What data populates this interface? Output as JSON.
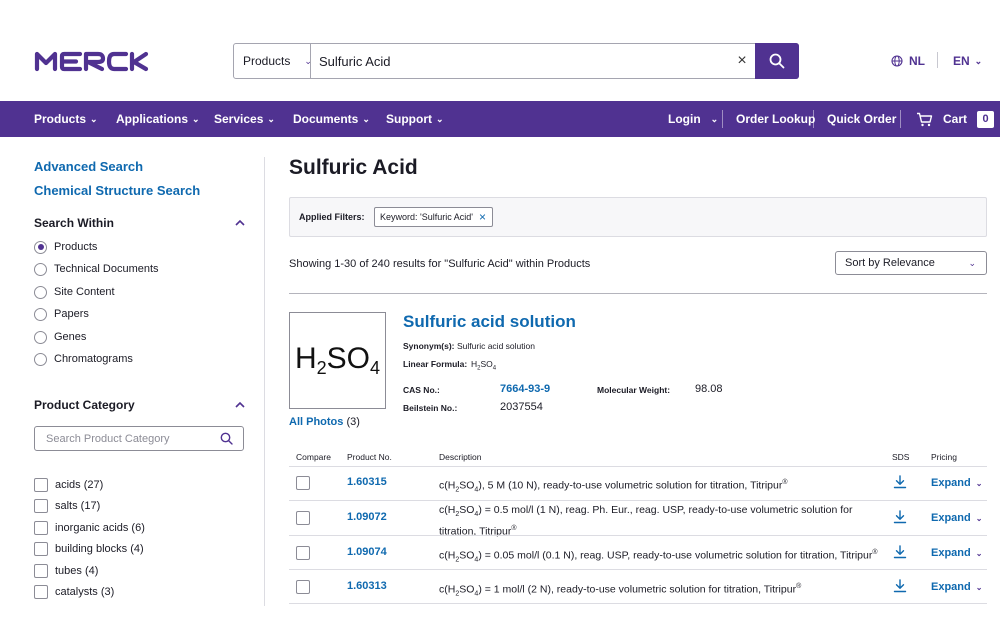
{
  "header": {
    "logo_text": "MERCK",
    "search_scope": "Products",
    "search_value": "Sulfuric Acid",
    "country": "NL",
    "language": "EN"
  },
  "nav": {
    "items": [
      {
        "label": "Products"
      },
      {
        "label": "Applications"
      },
      {
        "label": "Services"
      },
      {
        "label": "Documents"
      },
      {
        "label": "Support"
      }
    ],
    "login": "Login",
    "order_lookup": "Order Lookup",
    "quick_order": "Quick Order",
    "cart": "Cart",
    "cart_count": "0"
  },
  "sidebar": {
    "advanced_search": "Advanced Search",
    "structure_search": "Chemical Structure Search",
    "search_within_title": "Search Within",
    "search_within": [
      {
        "label": "Products",
        "selected": true
      },
      {
        "label": "Technical Documents",
        "selected": false
      },
      {
        "label": "Site Content",
        "selected": false
      },
      {
        "label": "Papers",
        "selected": false
      },
      {
        "label": "Genes",
        "selected": false
      },
      {
        "label": "Chromatograms",
        "selected": false
      }
    ],
    "category_title": "Product Category",
    "category_placeholder": "Search Product Category",
    "categories": [
      {
        "label": "acids (27)"
      },
      {
        "label": "salts (17)"
      },
      {
        "label": "inorganic acids (6)"
      },
      {
        "label": "building blocks (4)"
      },
      {
        "label": "tubes (4)"
      },
      {
        "label": "catalysts (3)"
      }
    ]
  },
  "main": {
    "title": "Sulfuric Acid",
    "applied_filters_label": "Applied Filters:",
    "filter_chip": "Keyword: 'Sulfuric Acid'",
    "results_text": "Showing 1-30 of 240 results for \"Sulfuric Acid\" within Products",
    "sort_label": "Sort by Relevance",
    "product": {
      "name": "Sulfuric acid solution",
      "synonyms_label": "Synonym(s):",
      "synonyms_value": "Sulfuric acid solution",
      "formula_label": "Linear Formula:",
      "cas_label": "CAS No.:",
      "cas_value": "7664-93-9",
      "mw_label": "Molecular Weight:",
      "mw_value": "98.08",
      "beilstein_label": "Beilstein No.:",
      "beilstein_value": "2037554",
      "all_photos": "All Photos",
      "photo_count": "(3)"
    },
    "table": {
      "headers": {
        "compare": "Compare",
        "product_no": "Product No.",
        "description": "Description",
        "sds": "SDS",
        "pricing": "Pricing"
      },
      "expand_label": "Expand",
      "rows": [
        {
          "product_no": "1.60315",
          "desc_after": ", 5 M (10 N), ready-to-use volumetric solution for titration, Titripur"
        },
        {
          "product_no": "1.09072",
          "desc_after": " = 0.5 mol/l (1 N), reag. Ph. Eur., reag. USP, ready-to-use volumetric solution for titration, Titripur"
        },
        {
          "product_no": "1.09074",
          "desc_after": " = 0.05 mol/l (0.1 N), reag. USP, ready-to-use volumetric solution for titration, Titripur"
        },
        {
          "product_no": "1.60313",
          "desc_after": " = 1 mol/l (2 N), ready-to-use volumetric solution for titration, Titripur"
        }
      ]
    }
  }
}
